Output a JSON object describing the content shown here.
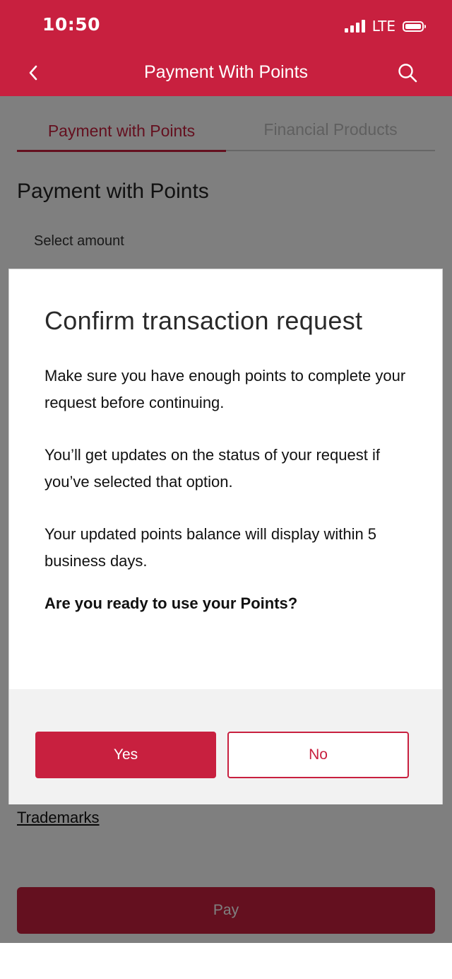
{
  "status_bar": {
    "time": "10:50",
    "network": "LTE",
    "icons": [
      "signal-icon",
      "battery-icon"
    ]
  },
  "nav": {
    "title": "Payment With Points",
    "icons": [
      "chevron-left-icon",
      "search-icon"
    ]
  },
  "tabs": [
    {
      "label": "Payment with Points",
      "active": true
    },
    {
      "label": "Financial Products",
      "active": false
    }
  ],
  "page": {
    "heading": "Payment with Points",
    "select_label": "Select amount",
    "trademarks_link": "Trademarks",
    "pay_button": "Pay"
  },
  "dialog": {
    "title": "Confirm transaction request",
    "paragraphs": [
      "Make sure you have enough points to complete your request before continuing.",
      "You’ll get updates on the status of your request if you’ve selected that option.",
      "Your updated points balance will display within 5 business days."
    ],
    "question": "Are you ready to use your Points?",
    "yes_label": "Yes",
    "no_label": "No"
  },
  "colors": {
    "brand": "#c8203f",
    "overlay": "rgba(0,0,0,0.5)"
  }
}
